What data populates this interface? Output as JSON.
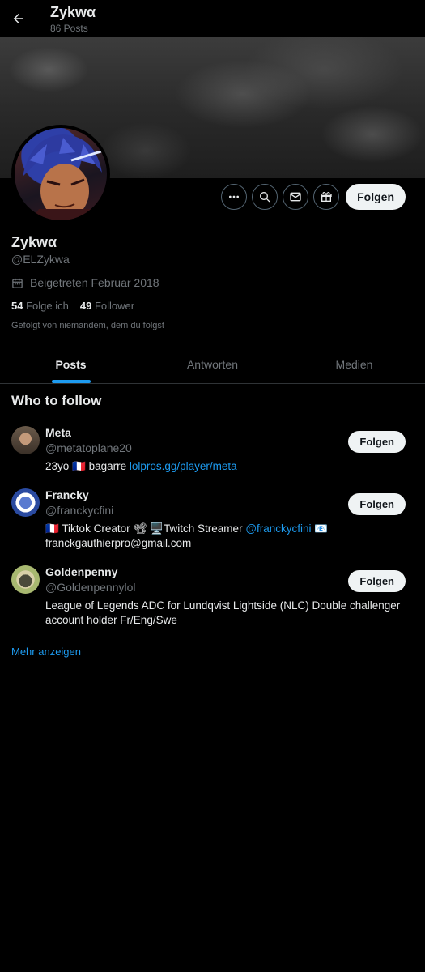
{
  "header": {
    "title": "Zykwα",
    "posts_count": "86 Posts"
  },
  "profile": {
    "name": "Zykwα",
    "handle": "@ELZykwa",
    "joined": "Beigetreten Februar 2018",
    "following_count": "54",
    "following_label": "Folge ich",
    "followers_count": "49",
    "followers_label": "Follower",
    "followed_by": "Gefolgt von niemandem, dem du folgst",
    "follow_button": "Folgen"
  },
  "tabs": [
    {
      "label": "Posts",
      "active": true
    },
    {
      "label": "Antworten",
      "active": false
    },
    {
      "label": "Medien",
      "active": false
    }
  ],
  "who_to_follow": {
    "title": "Who to follow",
    "follow_label": "Folgen",
    "more_label": "Mehr anzeigen",
    "accounts": [
      {
        "name": "Meta",
        "handle": "@metatoplane20",
        "bio_prefix": "23yo 🇫🇷 bagarre ",
        "bio_link": "lolpros.gg/player/meta",
        "bio_suffix": ""
      },
      {
        "name": "Francky",
        "handle": "@franckycfini",
        "bio_prefix": "🇫🇷 Tiktok Creator 📽 🖥️Twitch Streamer ",
        "bio_link": "@franckycfini",
        "bio_suffix": " 📧 franckgauthierpro@gmail.com"
      },
      {
        "name": "Goldenpenny",
        "handle": "@Goldenpennylol",
        "bio_prefix": "League of Legends ADC for Lundqvist Lightside (NLC) Double challenger account holder Fr/Eng/Swe",
        "bio_link": "",
        "bio_suffix": ""
      }
    ]
  },
  "icons": {
    "back": "arrow-left-icon",
    "more": "more-horizontal-icon",
    "search": "search-icon",
    "message": "envelope-icon",
    "gift": "gift-icon",
    "calendar": "calendar-icon"
  },
  "colors": {
    "accent": "#1d9bf0",
    "background": "#000000",
    "muted": "#71767b",
    "text": "#e7e9ea"
  }
}
